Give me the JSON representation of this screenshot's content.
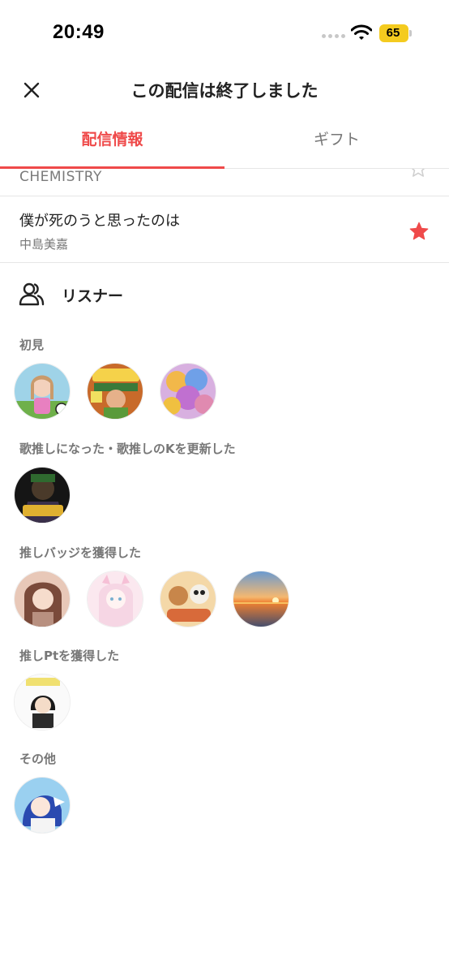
{
  "status_bar": {
    "time": "20:49",
    "battery": "65"
  },
  "header": {
    "title": "この配信は終了しました"
  },
  "tabs": [
    {
      "label": "配信情報"
    },
    {
      "label": "ギフト"
    }
  ],
  "songs": [
    {
      "title": "",
      "artist": "CHEMISTRY",
      "favorited": false
    },
    {
      "title": "僕が死のうと思ったのは",
      "artist": "中島美嘉",
      "favorited": true
    }
  ],
  "listeners": {
    "title": "リスナー",
    "sections": [
      {
        "label": "初見",
        "avatar_count": 3
      },
      {
        "label": "歌推しになった・歌推しのKを更新した",
        "avatar_count": 1
      },
      {
        "label": "推しバッジを獲得した",
        "avatar_count": 4
      },
      {
        "label": "推しPtを獲得した",
        "avatar_count": 1
      },
      {
        "label": "その他",
        "avatar_count": 1
      }
    ]
  },
  "colors": {
    "accent": "#ef4a4a",
    "battery": "#f4cb1f",
    "muted_text": "#777777",
    "divider": "#e6e6e6"
  }
}
